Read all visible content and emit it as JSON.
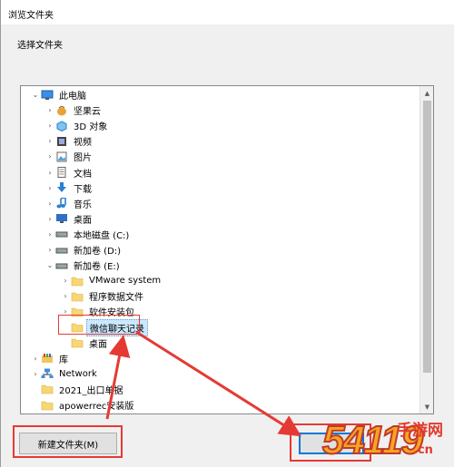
{
  "window": {
    "title": "浏览文件夹"
  },
  "instruction": "选择文件夹",
  "tree": {
    "items": [
      {
        "label": "此电脑",
        "icon": "computer-icon",
        "indent": 0,
        "chevron": "expanded"
      },
      {
        "label": "坚果云",
        "icon": "nutstore-icon",
        "indent": 1,
        "chevron": "collapsed"
      },
      {
        "label": "3D 对象",
        "icon": "cube-icon",
        "indent": 1,
        "chevron": "collapsed"
      },
      {
        "label": "视频",
        "icon": "video-icon",
        "indent": 1,
        "chevron": "collapsed"
      },
      {
        "label": "图片",
        "icon": "pictures-icon",
        "indent": 1,
        "chevron": "collapsed"
      },
      {
        "label": "文档",
        "icon": "document-icon",
        "indent": 1,
        "chevron": "collapsed"
      },
      {
        "label": "下载",
        "icon": "download-icon",
        "indent": 1,
        "chevron": "collapsed"
      },
      {
        "label": "音乐",
        "icon": "music-icon",
        "indent": 1,
        "chevron": "collapsed"
      },
      {
        "label": "桌面",
        "icon": "desktop-icon",
        "indent": 1,
        "chevron": "collapsed"
      },
      {
        "label": "本地磁盘 (C:)",
        "icon": "drive-icon",
        "indent": 1,
        "chevron": "collapsed"
      },
      {
        "label": "新加卷 (D:)",
        "icon": "drive-icon",
        "indent": 1,
        "chevron": "collapsed"
      },
      {
        "label": "新加卷 (E:)",
        "icon": "drive-icon",
        "indent": 1,
        "chevron": "expanded"
      },
      {
        "label": "VMware system",
        "icon": "folder-icon",
        "indent": 2,
        "chevron": "collapsed"
      },
      {
        "label": "程序数据文件",
        "icon": "folder-icon",
        "indent": 2,
        "chevron": "collapsed"
      },
      {
        "label": "软件安装包",
        "icon": "folder-icon",
        "indent": 2,
        "chevron": "collapsed"
      },
      {
        "label": "微信聊天记录",
        "icon": "folder-icon",
        "indent": 2,
        "chevron": "none",
        "selected": true
      },
      {
        "label": "桌面",
        "icon": "folder-icon",
        "indent": 2,
        "chevron": "none"
      },
      {
        "label": "库",
        "icon": "library-icon",
        "indent": 0,
        "chevron": "collapsed"
      },
      {
        "label": "Network",
        "icon": "network-icon",
        "indent": 0,
        "chevron": "collapsed"
      },
      {
        "label": "2021_出口单据",
        "icon": "folder-icon",
        "indent": 0,
        "chevron": "none"
      },
      {
        "label": "apowerrec安装版",
        "icon": "folder-icon",
        "indent": 0,
        "chevron": "none"
      },
      {
        "label": "",
        "icon": "folder-icon",
        "indent": 0,
        "chevron": "none"
      }
    ]
  },
  "buttons": {
    "new_folder": "新建文件夹(M)",
    "ok": ""
  },
  "watermark": {
    "number": "54119",
    "text": "手游网",
    "domain": ".cn"
  },
  "colors": {
    "accent_red": "#e53a34",
    "selection": "#cce8ff",
    "folder": "#f7d774",
    "watermark_orange": "#f5a51f"
  }
}
